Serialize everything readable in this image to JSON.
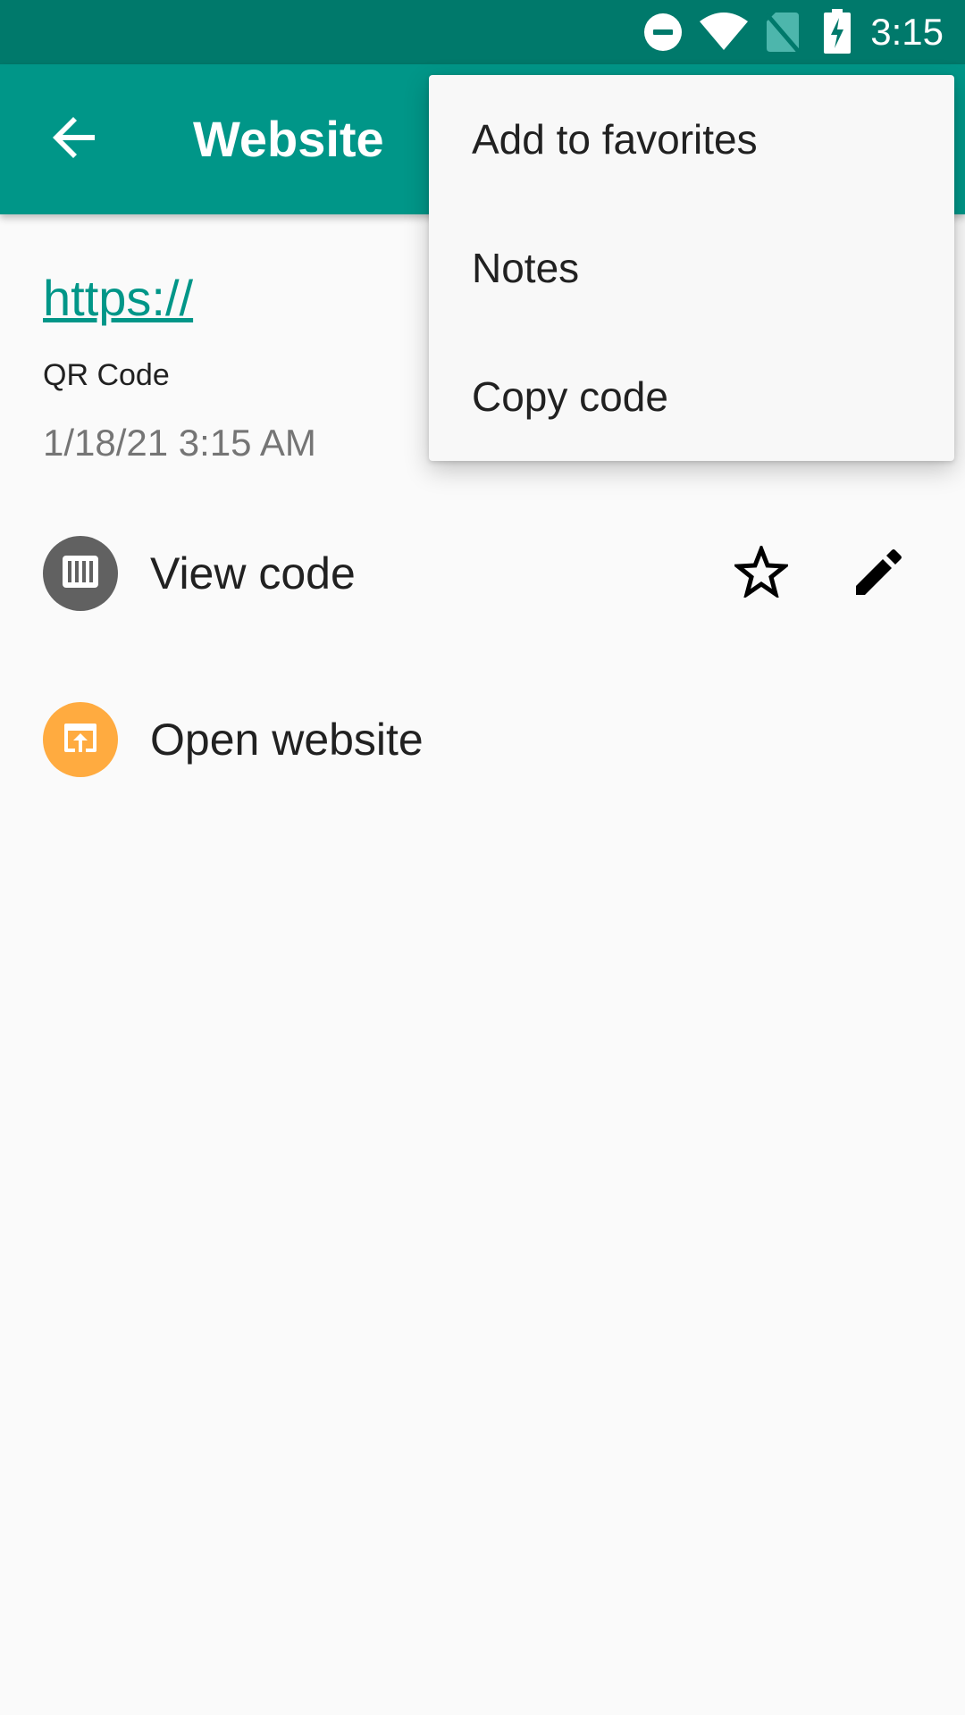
{
  "status_bar": {
    "time": "3:15",
    "icons": [
      "do-not-disturb-icon",
      "wifi-icon",
      "no-sim-icon",
      "battery-charging-icon"
    ]
  },
  "app_bar": {
    "title": "Website",
    "back_icon": "arrow-back-icon"
  },
  "barcode": {
    "text": "https://",
    "format": "QR Code",
    "date": "1/18/21 3:15 AM"
  },
  "actions": [
    {
      "label": "View code",
      "icon": "barcode-icon",
      "color": "#616161"
    },
    {
      "label": "Open website",
      "icon": "open-in-browser-icon",
      "color": "#ffab40"
    }
  ],
  "row_icons": [
    "star-outline-icon",
    "edit-pencil-icon"
  ],
  "menu": {
    "items": [
      {
        "label": "Add to favorites"
      },
      {
        "label": "Notes"
      },
      {
        "label": "Copy code"
      }
    ]
  },
  "colors": {
    "primary": "#009688",
    "primary_dark": "#00796b",
    "background": "#fafafa",
    "accent_orange": "#ffab40"
  }
}
